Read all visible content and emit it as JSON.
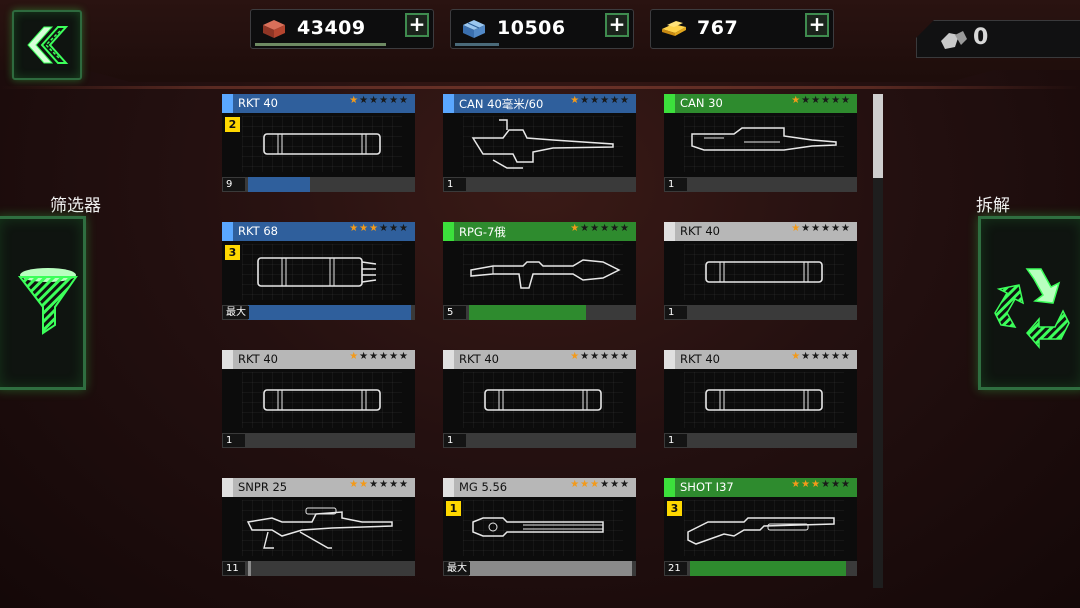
{
  "resources": [
    {
      "id": "bricks",
      "value": "43409",
      "plus": "+",
      "fill": 0.75,
      "bar_color": "#6e8a63"
    },
    {
      "id": "crates",
      "value": "10506",
      "plus": "+",
      "fill": 0.25,
      "bar_color": "#4a6a7a"
    },
    {
      "id": "gold",
      "value": "767",
      "plus": "+",
      "fill": 0.0,
      "bar_color": "#888"
    }
  ],
  "gems": {
    "value": "0"
  },
  "sidebar": {
    "filter_label": "筛选器",
    "dismantle_label": "拆解"
  },
  "colors": {
    "blue": "#2f5f9c",
    "green": "#2e8b2e",
    "gray": "#8a8a8a",
    "accent": "#3cff5a",
    "star": "#f39a1a",
    "grade": "#ffd800"
  },
  "weapons": [
    {
      "name": "RKT 40",
      "rarity": "blue",
      "stars": 1,
      "grade": "2",
      "count": "9",
      "fill": 0.38,
      "art": "rkt40"
    },
    {
      "name": "CAN 40毫米/60",
      "rarity": "blue",
      "stars": 1,
      "grade": "",
      "count": "1",
      "fill": 0.0,
      "art": "can40"
    },
    {
      "name": "CAN 30",
      "rarity": "green",
      "stars": 1,
      "grade": "",
      "count": "1",
      "fill": 0.0,
      "art": "can30"
    },
    {
      "name": "RKT 68",
      "rarity": "blue",
      "stars": 3,
      "grade": "3",
      "count": "最大",
      "fill": 1.0,
      "art": "rkt68"
    },
    {
      "name": "RPG-7俄",
      "rarity": "green",
      "stars": 1,
      "grade": "",
      "count": "5",
      "fill": 0.72,
      "art": "rpg7"
    },
    {
      "name": "RKT 40",
      "rarity": "gray",
      "stars": 1,
      "grade": "",
      "count": "1",
      "fill": 0.0,
      "art": "rkt40"
    },
    {
      "name": "RKT 40",
      "rarity": "gray",
      "stars": 1,
      "grade": "",
      "count": "1",
      "fill": 0.0,
      "art": "rkt40"
    },
    {
      "name": "RKT 40",
      "rarity": "gray",
      "stars": 1,
      "grade": "",
      "count": "1",
      "fill": 0.0,
      "art": "rkt40"
    },
    {
      "name": "RKT 40",
      "rarity": "gray",
      "stars": 1,
      "grade": "",
      "count": "1",
      "fill": 0.0,
      "art": "rkt40"
    },
    {
      "name": "SNPR 25",
      "rarity": "gray",
      "stars": 2,
      "grade": "",
      "count": "11",
      "fill": 0.02,
      "art": "snpr"
    },
    {
      "name": "MG 5.56",
      "rarity": "gray",
      "stars": 3,
      "grade": "1",
      "count": "最大",
      "fill": 1.0,
      "art": "mg"
    },
    {
      "name": "SHOT I37",
      "rarity": "green",
      "stars": 3,
      "grade": "3",
      "count": "21",
      "fill": 0.96,
      "art": "shotgun"
    }
  ],
  "scrollbar": {
    "position": 0.0
  }
}
